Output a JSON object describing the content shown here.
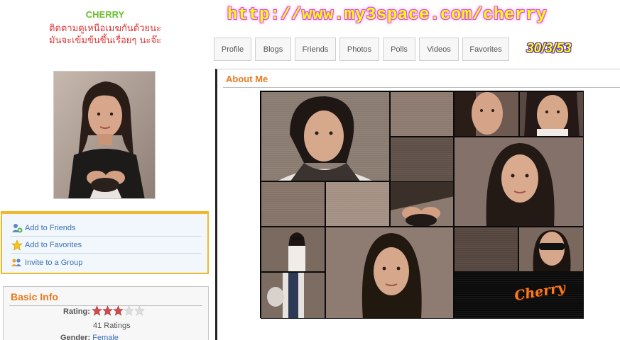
{
  "profile": {
    "name": "CHERRY",
    "message_line1": "ติดตามดูเหนือเมฆกันด้วยนะ",
    "message_line2": "มันจะเข้มข้นขึ้นเรื่อยๆ นะจ๊ะ"
  },
  "banner": {
    "url": "http://www.my3space.com/cherry",
    "date": "30/3/53",
    "url_color": "#ffff00",
    "glow_color": "#d94eff"
  },
  "tabs": [
    {
      "label": "Profile"
    },
    {
      "label": "Blogs"
    },
    {
      "label": "Friends"
    },
    {
      "label": "Photos"
    },
    {
      "label": "Polls"
    },
    {
      "label": "Videos"
    },
    {
      "label": "Favorites"
    }
  ],
  "actions": [
    {
      "label": "Add to Friends",
      "icon": "add-friend-icon"
    },
    {
      "label": "Add to Favorites",
      "icon": "star-icon"
    },
    {
      "label": "Invite to a Group",
      "icon": "group-icon"
    }
  ],
  "basic_info": {
    "title": "Basic Info",
    "rating_label": "Rating:",
    "rating_value": 3,
    "rating_max": 5,
    "ratings_count": "41 Ratings",
    "gender_label": "Gender:",
    "gender_value": "Female"
  },
  "about": {
    "title": "About Me",
    "collage_signature": "Cherry"
  },
  "colors": {
    "accent_orange": "#e87a1e",
    "link_blue": "#3b6fb6",
    "name_green": "#6bbf2d",
    "message_red": "#e03636",
    "panel_border": "#f2b72d"
  }
}
